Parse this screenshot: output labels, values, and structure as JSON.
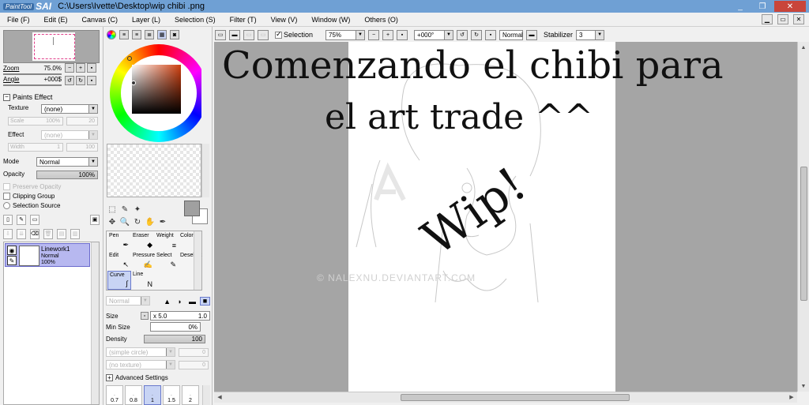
{
  "window": {
    "app_logo_text": "PaintTool",
    "app_logo_sai": "SAI",
    "title": "C:\\Users\\Ivette\\Desktop\\wip chibi .png",
    "controls": [
      "_",
      "❐",
      "✕"
    ]
  },
  "menu": [
    "File (F)",
    "Edit (E)",
    "Canvas (C)",
    "Layer (L)",
    "Selection (S)",
    "Filter (T)",
    "View (V)",
    "Window (W)",
    "Others (O)"
  ],
  "navigator": {
    "zoom_label": "Zoom",
    "zoom_value": "75.0%",
    "angle_label": "Angle",
    "angle_value": "+000$"
  },
  "paints_effect": {
    "header": "Paints Effect",
    "texture_label": "Texture",
    "texture_value": "(none)",
    "scale_label": "Scale",
    "scale_value": "100%",
    "scale_value2": "20",
    "effect_label": "Effect",
    "effect_value": "(none)",
    "width_label": "Width",
    "width_value": "1",
    "width_value2": "100"
  },
  "layer_props": {
    "mode_label": "Mode",
    "mode_value": "Normal",
    "opacity_label": "Opacity",
    "opacity_value": "100%",
    "preserve_opacity": "Preserve Opacity",
    "clipping_group": "Clipping Group",
    "selection_source": "Selection Source"
  },
  "layers": [
    {
      "name": "Linework1",
      "mode": "Normal",
      "opacity": "100%"
    }
  ],
  "brushes": {
    "row1": [
      "Pen",
      "Eraser",
      "Weight",
      "Color"
    ],
    "row2": [
      "Edit",
      "Pressure",
      "Select",
      "Deselect"
    ],
    "row3": [
      "Curve",
      "Line"
    ]
  },
  "tool_props": {
    "blend_value": "Normal",
    "size_label": "Size",
    "size_mult": "x 5.0",
    "size_value": "1.0",
    "min_size_label": "Min Size",
    "min_size_value": "0%",
    "density_label": "Density",
    "density_value": "100",
    "shape_value": "(simple circle)",
    "shape_num": "0",
    "texture_value": "(no texture)",
    "texture_num": "0",
    "advanced_settings": "Advanced Settings",
    "size_presets": [
      "0.7",
      "0.8",
      "1",
      "1.5",
      "2"
    ]
  },
  "toolbar": {
    "selection_label": "Selection",
    "zoom_value": "75%",
    "angle_value": "+000°",
    "mode_value": "Normal",
    "stabilizer_label": "Stabilizer",
    "stabilizer_value": "3"
  },
  "canvas": {
    "caption_line1": "Comenzando el chibi para",
    "caption_line2": "el art trade ^^",
    "wip_text": "Wip!",
    "watermark": "© NALEXNU.DEVIANTART.COM"
  }
}
